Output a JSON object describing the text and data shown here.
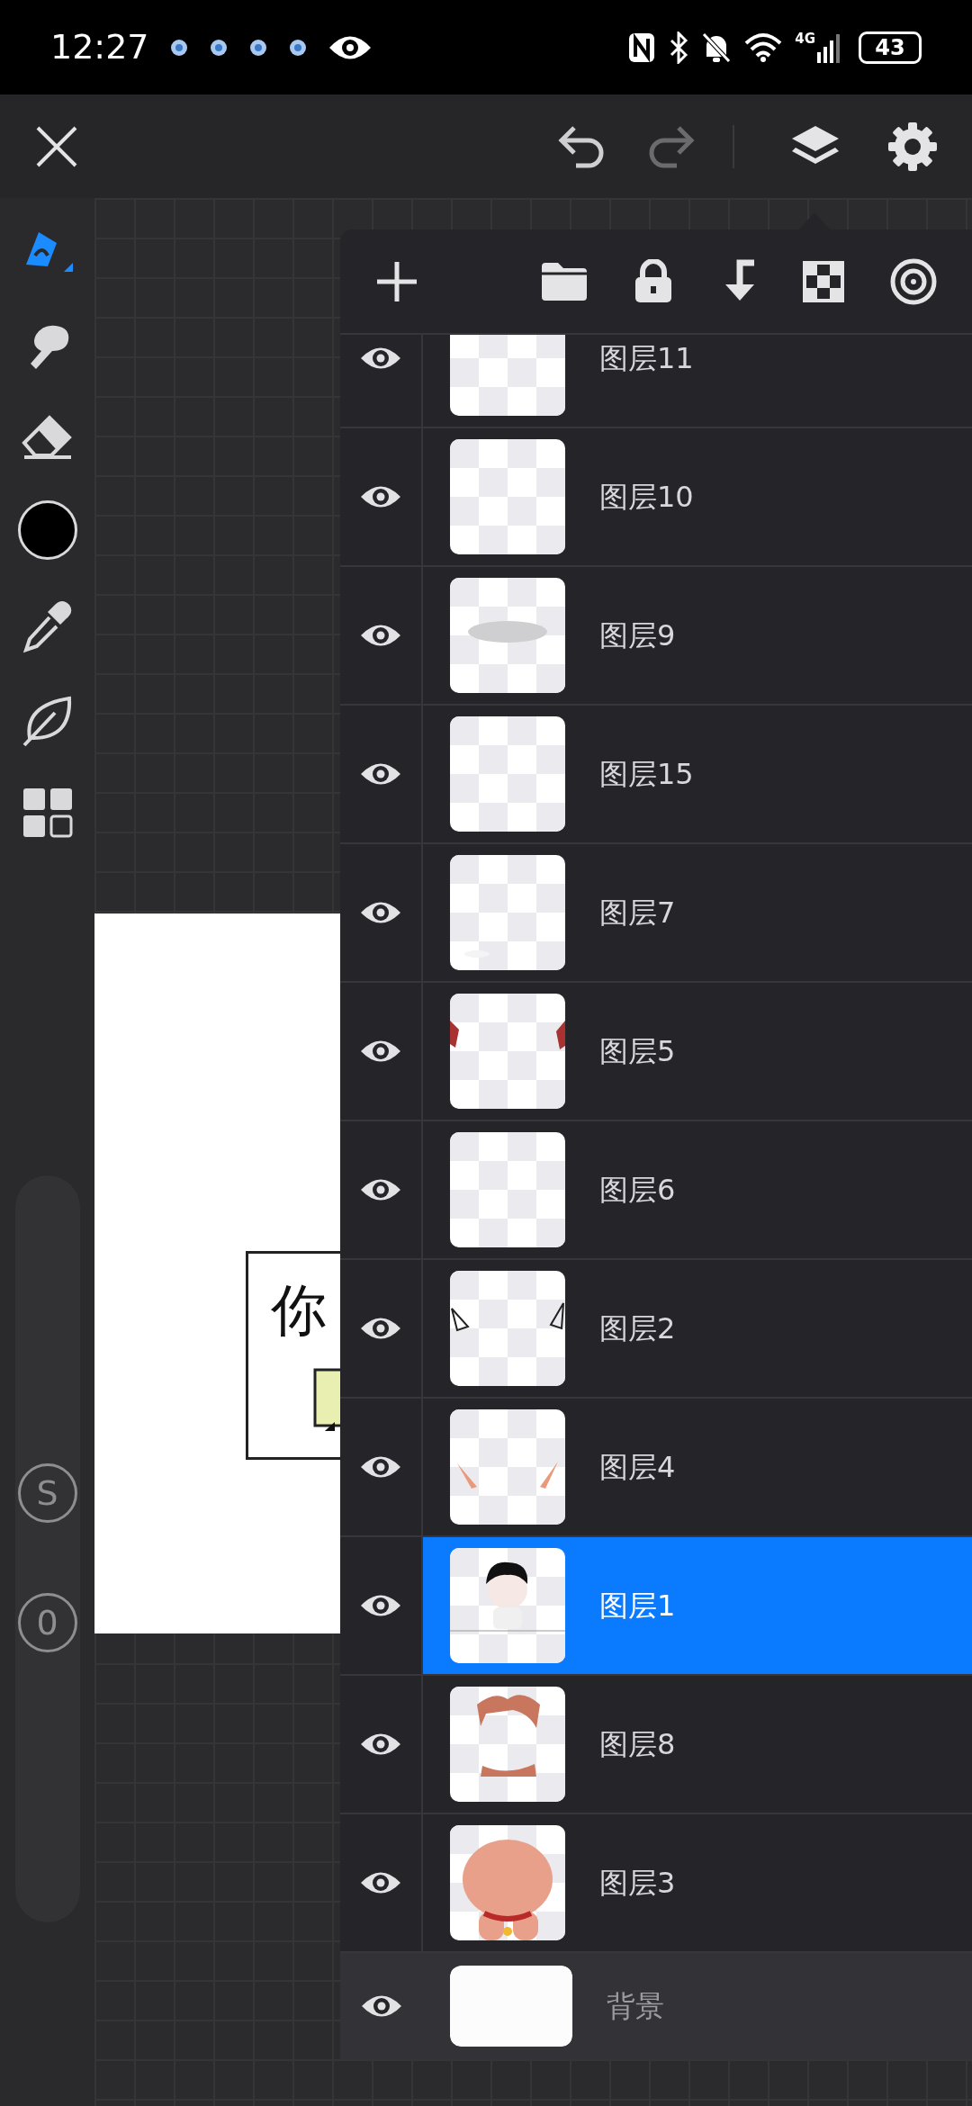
{
  "status_bar": {
    "time": "12:27",
    "network": "4G",
    "battery": "43"
  },
  "tools": [
    {
      "kind": "pen",
      "selected": true
    },
    {
      "kind": "smudge",
      "selected": false
    },
    {
      "kind": "eraser",
      "selected": false
    },
    {
      "kind": "color",
      "selected": false,
      "color": "#000000"
    },
    {
      "kind": "eyedropper",
      "selected": false
    },
    {
      "kind": "leaf",
      "selected": false
    },
    {
      "kind": "grid",
      "selected": false
    }
  ],
  "side_buttons": [
    "S",
    "0"
  ],
  "canvas": {
    "question": "你"
  },
  "layers": [
    {
      "kind": "layer",
      "name": "图层11",
      "visible": true,
      "selected": false
    },
    {
      "kind": "layer",
      "name": "图层10",
      "visible": true,
      "selected": false
    },
    {
      "kind": "layer",
      "name": "图层9",
      "visible": true,
      "selected": false
    },
    {
      "kind": "layer",
      "name": "图层15",
      "visible": true,
      "selected": false
    },
    {
      "kind": "layer",
      "name": "图层7",
      "visible": true,
      "selected": false
    },
    {
      "kind": "layer",
      "name": "图层5",
      "visible": true,
      "selected": false
    },
    {
      "kind": "layer",
      "name": "图层6",
      "visible": true,
      "selected": false
    },
    {
      "kind": "layer",
      "name": "图层2",
      "visible": true,
      "selected": false
    },
    {
      "kind": "layer",
      "name": "图层4",
      "visible": true,
      "selected": false
    },
    {
      "kind": "layer",
      "name": "图层1",
      "visible": true,
      "selected": true
    },
    {
      "kind": "layer",
      "name": "图层8",
      "visible": true,
      "selected": false
    },
    {
      "kind": "layer",
      "name": "图层3",
      "visible": true,
      "selected": false
    },
    {
      "kind": "background",
      "name": "背景",
      "visible": true,
      "selected": false
    }
  ]
}
